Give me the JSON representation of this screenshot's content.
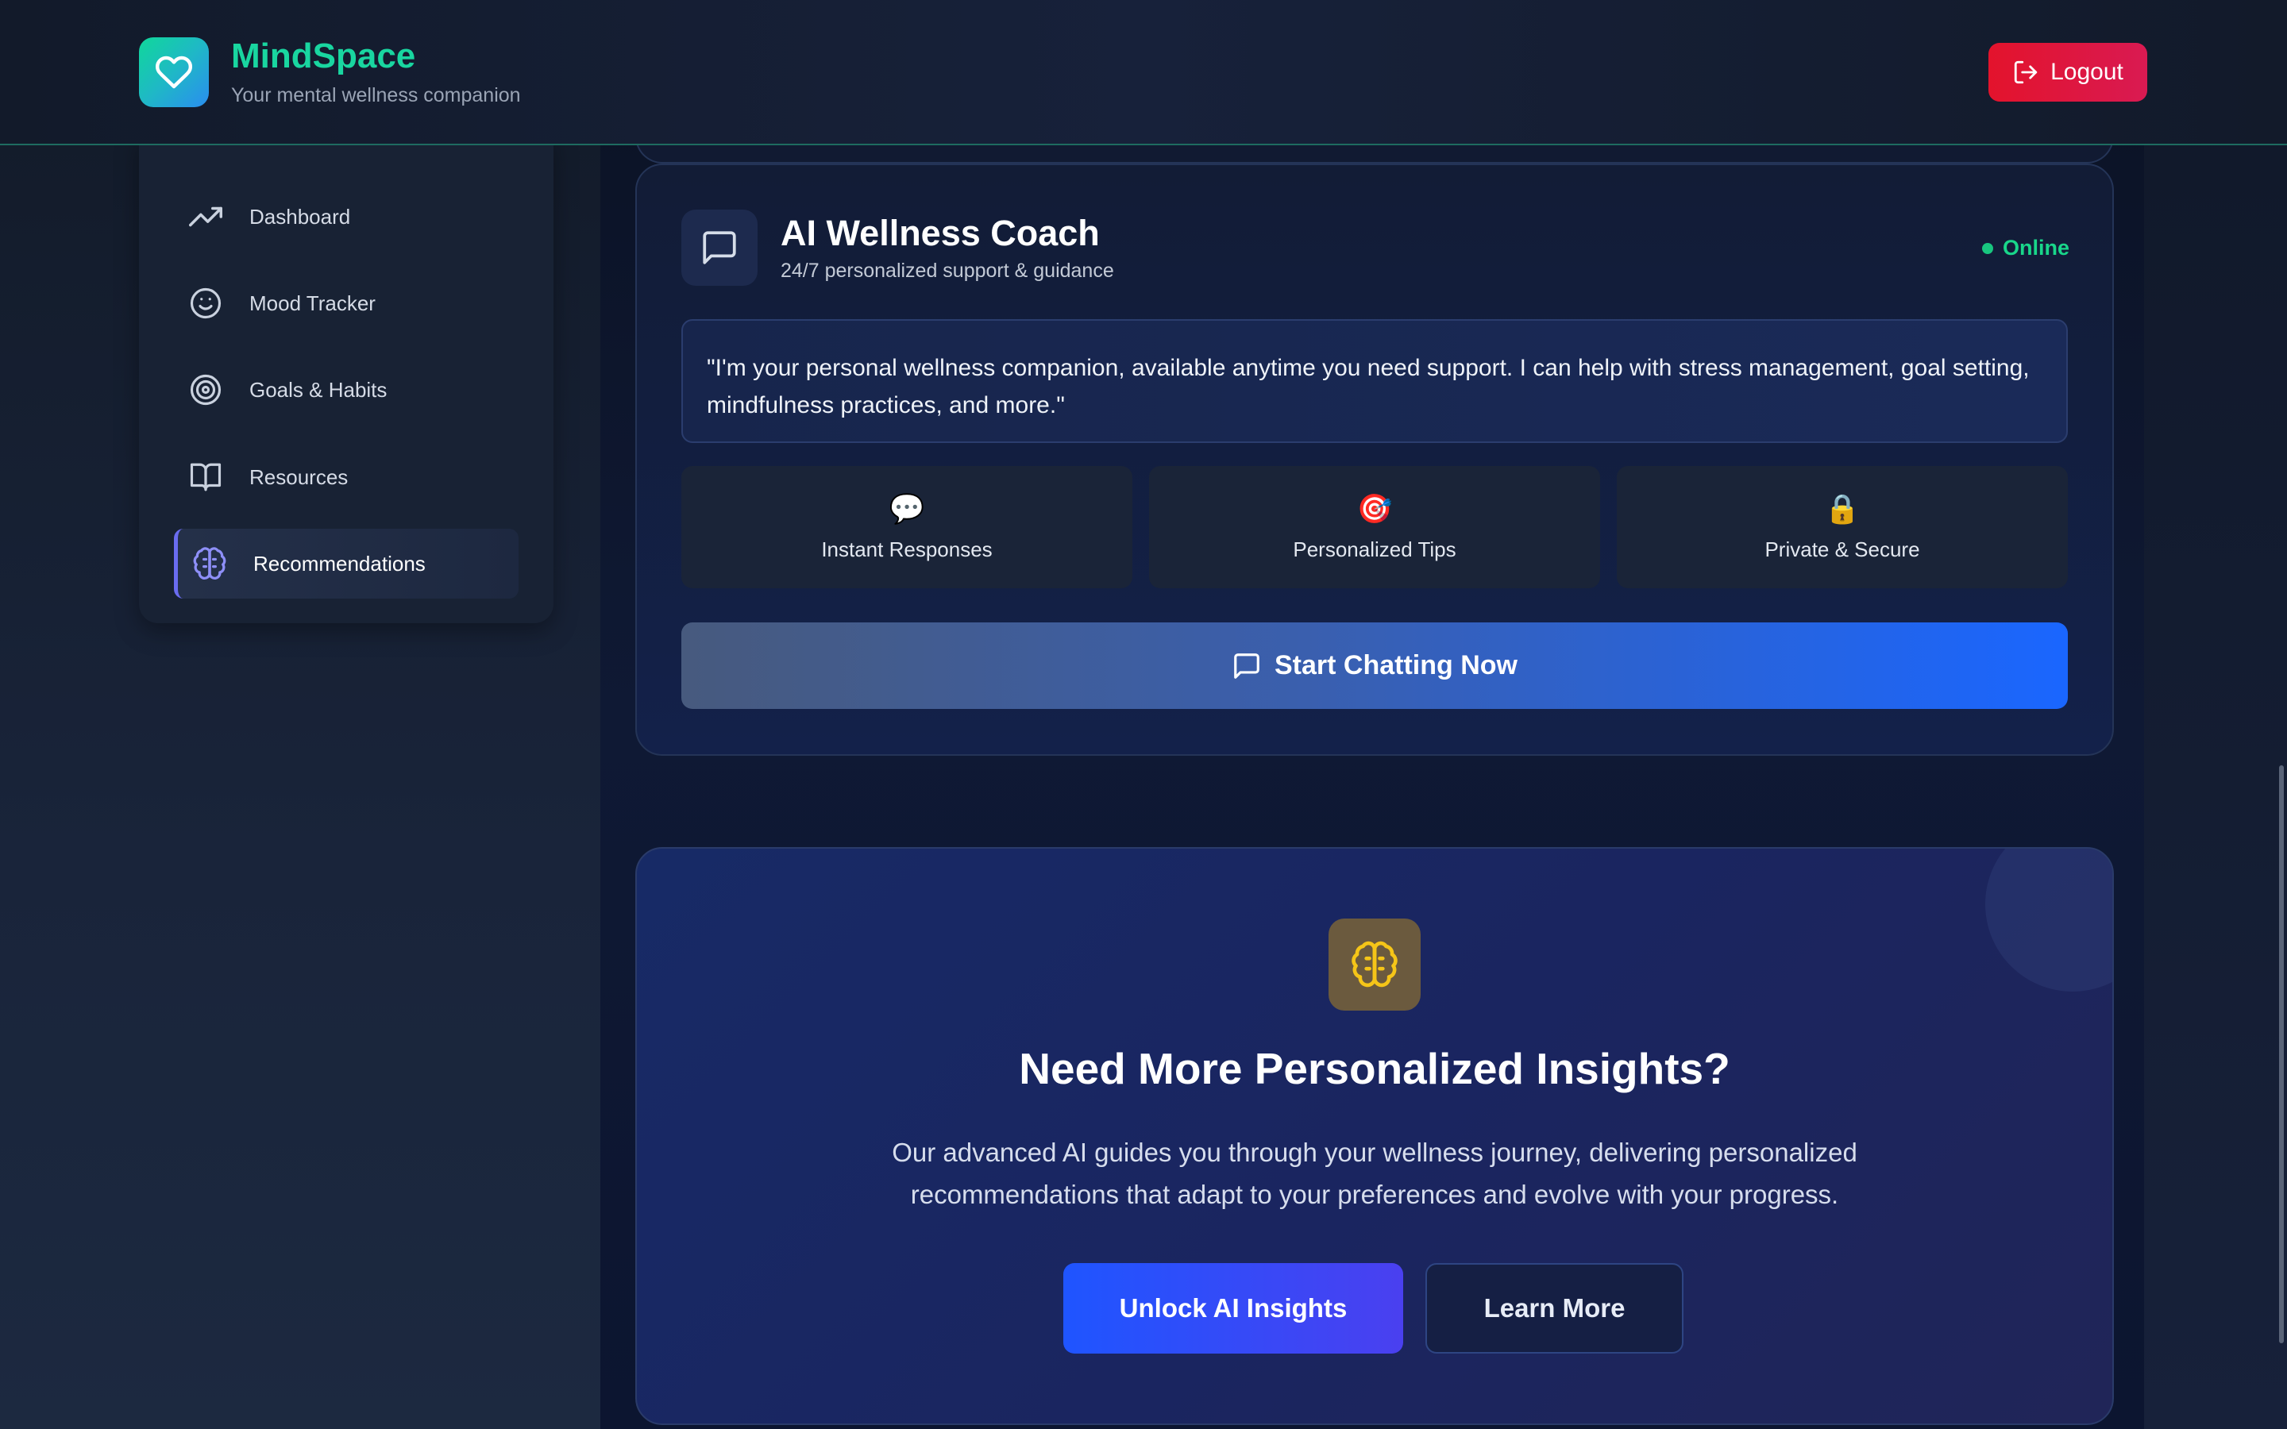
{
  "header": {
    "brand_name": "MindSpace",
    "tagline": "Your mental wellness companion",
    "logout_label": "Logout"
  },
  "sidebar": {
    "items": [
      {
        "label": "Dashboard",
        "icon": "trending-up-icon"
      },
      {
        "label": "Mood Tracker",
        "icon": "smile-icon"
      },
      {
        "label": "Goals & Habits",
        "icon": "target-icon"
      },
      {
        "label": "Resources",
        "icon": "book-icon"
      },
      {
        "label": "Recommendations",
        "icon": "brain-icon",
        "active": true
      }
    ]
  },
  "coach": {
    "title": "AI Wellness Coach",
    "subtitle": "24/7 personalized support & guidance",
    "status": "Online",
    "quote": "\"I'm your personal wellness companion, available anytime you need support. I can help with stress management, goal setting, mindfulness practices, and more.\"",
    "features": [
      {
        "icon": "💬",
        "label": "Instant Responses"
      },
      {
        "icon": "🎯",
        "label": "Personalized Tips"
      },
      {
        "icon": "🔒",
        "label": "Private & Secure"
      }
    ],
    "cta_label": "Start Chatting Now"
  },
  "insights": {
    "title": "Need More Personalized Insights?",
    "description": "Our advanced AI guides you through your wellness journey, delivering personalized recommendations that adapt to your preferences and evolve with your progress.",
    "primary_label": "Unlock AI Insights",
    "secondary_label": "Learn More"
  },
  "colors": {
    "brand": "#19d6a0",
    "logout": "#e3132c",
    "online": "#19d68a",
    "active_accent": "#6a6cf0",
    "primary_button": "#1f55ff"
  }
}
